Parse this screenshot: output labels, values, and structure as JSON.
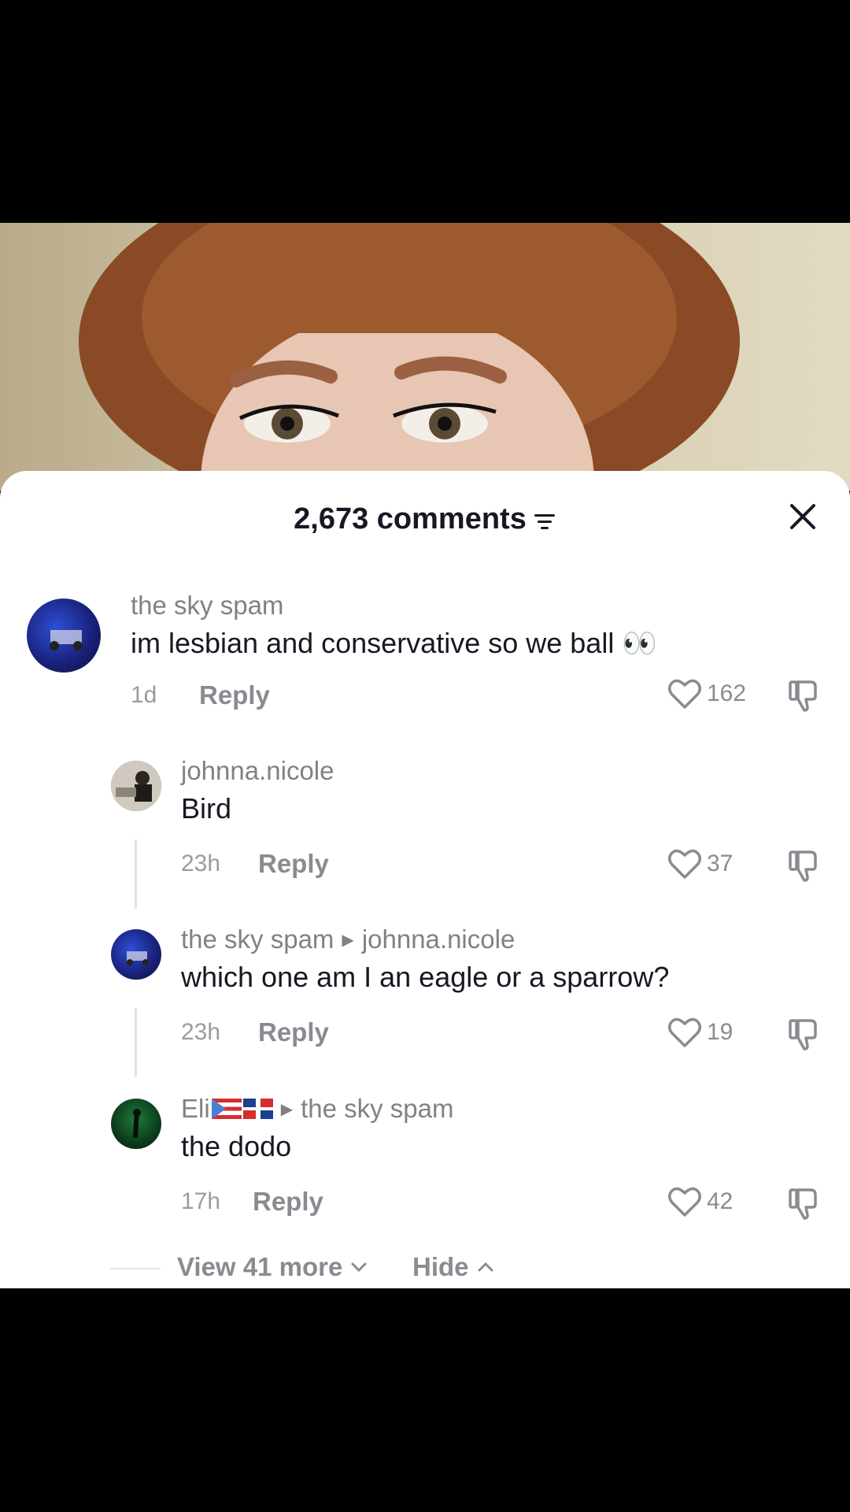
{
  "sheet": {
    "comments_count": "2,673 comments",
    "filter_icon": "filter-icon",
    "close_icon": "close-icon"
  },
  "comments": [
    {
      "username": "the sky spam",
      "text": "im lesbian and conservative so we ball 👀",
      "time": "1d",
      "reply_label": "Reply",
      "likes": "162"
    },
    {
      "username": "johnna.nicole",
      "text": "Bird",
      "time": "23h",
      "reply_label": "Reply",
      "likes": "37"
    },
    {
      "username": "the sky spam",
      "reply_to": "johnna.nicole",
      "text": "which one am I an eagle or a sparrow?",
      "time": "23h",
      "reply_label": "Reply",
      "likes": "19"
    },
    {
      "username": "Eli",
      "reply_to": "the sky spam",
      "text": "the dodo",
      "time": "17h",
      "reply_label": "Reply",
      "likes": "42"
    }
  ],
  "footer": {
    "view_more": "View 41 more",
    "hide": "Hide"
  },
  "colors": {
    "text_primary": "#161823",
    "text_secondary": "#808185",
    "background": "#000000",
    "sheet": "#ffffff"
  }
}
